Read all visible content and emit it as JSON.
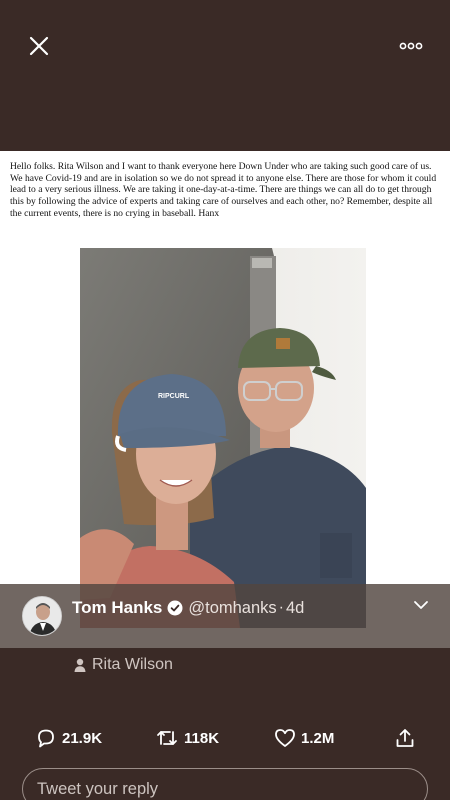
{
  "header": {
    "close_icon": "close-icon",
    "more_icon": "more-horizontal-icon"
  },
  "note": {
    "text": "Hello folks. Rita Wilson and I want to thank everyone here Down Under who are taking such good care of us. We have Covid-19 and are in isolation so we do not spread it to anyone else. There are those for whom it could lead to a very serious illness. We are taking it one-day-at-a-time. There are things we can all do to get through this by following the advice of experts and taking care of ourselves and each other, no? Remember, despite all the current events, there is no crying in baseball. Hanx"
  },
  "photo": {
    "cap_text": "RIPCURL"
  },
  "tweet": {
    "name": "Tom Hanks",
    "handle": "@tomhanks",
    "separator": "·",
    "time": "4d",
    "tagged_user": "Rita Wilson"
  },
  "actions": {
    "replies": "21.9K",
    "retweets": "118K",
    "likes": "1.2M"
  },
  "reply": {
    "placeholder": "Tweet your reply"
  },
  "colors": {
    "background": "#3a2a26",
    "verified": "#ffffff"
  }
}
